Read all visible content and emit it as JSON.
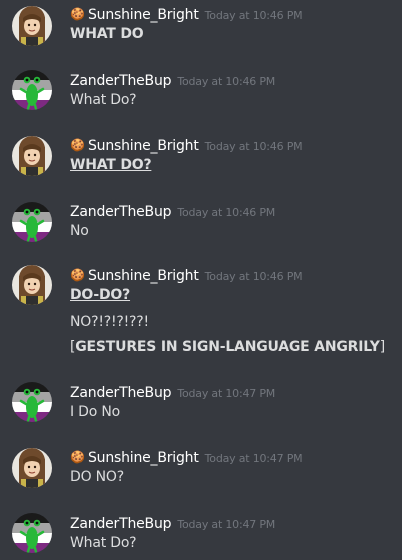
{
  "colors": {
    "background": "#36393f",
    "username": "#ffffff",
    "text": "#dcddde",
    "timestamp": "#72767d"
  },
  "avatars": {
    "Sunshine_Bright": "brown-haired-character-avatar",
    "ZanderTheBup": "green-frog-on-asexual-flag-avatar"
  },
  "messages": [
    {
      "author": "Sunshine_Bright",
      "badge_icon": "cookie-icon",
      "timestamp": "Today at 10:46 PM",
      "lines": [
        "WHAT DO"
      ]
    },
    {
      "author": "ZanderTheBup",
      "timestamp": "Today at 10:46 PM",
      "lines": [
        "What Do?"
      ]
    },
    {
      "author": "Sunshine_Bright",
      "badge_icon": "cookie-icon",
      "timestamp": "Today at 10:46 PM",
      "lines": [
        "WHAT DO?"
      ]
    },
    {
      "author": "ZanderTheBup",
      "timestamp": "Today at 10:46 PM",
      "lines": [
        "No"
      ]
    },
    {
      "author": "Sunshine_Bright",
      "badge_icon": "cookie-icon",
      "timestamp": "Today at 10:46 PM",
      "lines": [
        "DO-DO?",
        "NO?!?!?!??!"
      ],
      "line3": {
        "open": "[",
        "bold": "GESTURES IN SIGN-LANGUAGE ANGRILY",
        "close": "]"
      }
    },
    {
      "author": "ZanderTheBup",
      "timestamp": "Today at 10:47 PM",
      "lines": [
        "I Do No"
      ]
    },
    {
      "author": "Sunshine_Bright",
      "badge_icon": "cookie-icon",
      "timestamp": "Today at 10:47 PM",
      "lines": [
        "DO NO?"
      ]
    },
    {
      "author": "ZanderTheBup",
      "timestamp": "Today at 10:47 PM",
      "lines": [
        "What Do?"
      ]
    }
  ]
}
